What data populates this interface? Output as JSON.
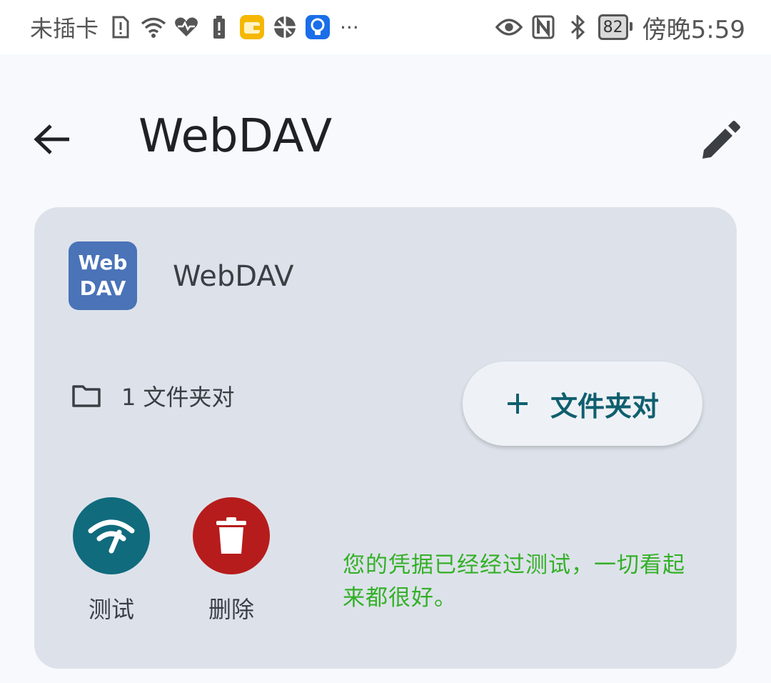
{
  "status_bar": {
    "carrier": "未插卡",
    "more": "···",
    "battery": "82",
    "time": "傍晚5:59",
    "left_icons": [
      "sim-alert-icon",
      "wifi-icon",
      "health-heart-icon",
      "battery-warning-icon",
      "wallet-app-icon",
      "browser-globe-icon",
      "bulb-app-icon"
    ],
    "right_icons": [
      "eye-icon",
      "nfc-icon",
      "bluetooth-icon"
    ]
  },
  "app_bar": {
    "title": "WebDAV",
    "back_icon": "arrow-left-icon",
    "edit_icon": "pencil-icon"
  },
  "card": {
    "logo_line1": "Web",
    "logo_line2": "DAV",
    "provider_name": "WebDAV",
    "folder_icon": "folder-icon",
    "folder_count": "1 文件夹对",
    "add_button_icon": "plus-icon",
    "add_button_label": "文件夹对",
    "test_label": "测试",
    "test_icon": "wifi-signal-icon",
    "delete_label": "删除",
    "delete_icon": "trash-icon",
    "status_message": "您的凭据已经经过测试，一切看起来都很好。"
  },
  "colors": {
    "card_background": "#dde2ea",
    "accent_teal": "#106b7d",
    "delete_red": "#b71c1c",
    "success_green": "#34b028",
    "logo_blue": "#4a73b8"
  }
}
